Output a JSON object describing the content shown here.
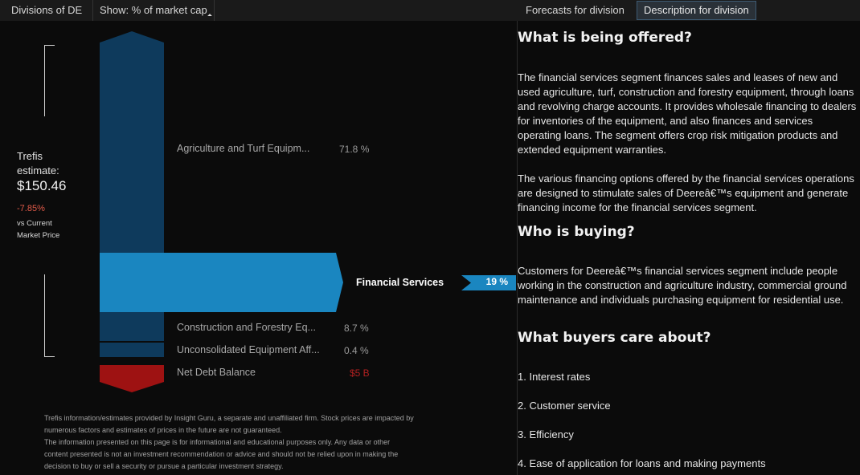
{
  "tabs": {
    "divisions": "Divisions of DE",
    "show": "Show: % of market cap",
    "forecasts": "Forecasts for division",
    "description": "Description for division"
  },
  "estimate": {
    "label_line1": "Trefis",
    "label_line2": "estimate:",
    "price": "$150.46",
    "change": "-7.85%",
    "vs_line1": "vs Current",
    "vs_line2": "Market Price"
  },
  "segments": [
    {
      "name": "Agriculture and Turf Equipm...",
      "value": "71.8 %"
    },
    {
      "name": "Financial Services",
      "value": "19 %"
    },
    {
      "name": "Construction and Forestry Eq...",
      "value": "8.7 %"
    },
    {
      "name": "Unconsolidated Equipment Aff...",
      "value": "0.4 %"
    },
    {
      "name": "Net Debt Balance",
      "value": "$5 B"
    }
  ],
  "colors": {
    "dark_blue": "#0e3a5c",
    "highlight_blue": "#1a86c0",
    "debt_red": "#9e1212"
  },
  "disclaimer": {
    "line1": "Trefis information/estimates provided by Insight Guru, a separate and unaffiliated firm. Stock prices are impacted by",
    "line2": "numerous factors and estimates of prices in the future are not guaranteed.",
    "line3": "The information presented on this page is for informational and educational purposes only. Any data or other",
    "line4": "content presented is not an investment recommendation or advice and should not be relied upon in making the",
    "line5": "decision to buy or sell a security or pursue a particular investment strategy."
  },
  "description": {
    "h_offered": "What is being offered?",
    "p_offered_1": "The financial services segment finances sales and leases of new and used agriculture, turf, construction and forestry equipment, through loans and revolving charge accounts. It provides wholesale financing to dealers for inventories of the equipment, and also finances and services operating loans. The segment offers crop risk mitigation products and extended equipment warranties.",
    "p_offered_2": "The various financing options offered by the financial services operations are designed to stimulate sales of Deereâ€™s equipment and generate financing income for the financial services segment.",
    "h_buying": "Who is buying?",
    "p_buying": "Customers for Deereâ€™s financial services segment include people working in the construction and agriculture industry, commercial ground maintenance and individuals purchasing equipment for residential use.",
    "h_care": "What buyers care about?",
    "care_items": [
      "1. Interest rates",
      "2. Customer service",
      "3. Efficiency",
      "4. Ease of application for loans and making payments"
    ]
  }
}
